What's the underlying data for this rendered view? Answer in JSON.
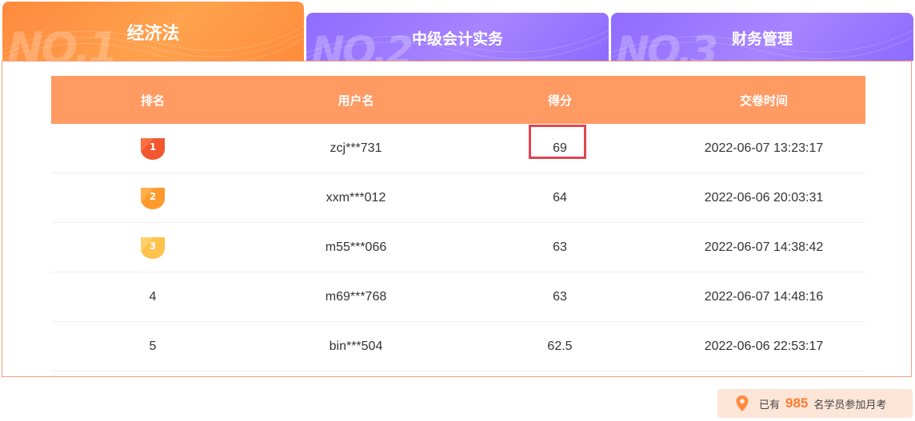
{
  "tabs": [
    {
      "label": "经济法",
      "watermark": "NO.1",
      "active": true
    },
    {
      "label": "中级会计实务",
      "watermark": "NO.2",
      "active": false
    },
    {
      "label": "财务管理",
      "watermark": "NO.3",
      "active": false
    }
  ],
  "table": {
    "headers": [
      "排名",
      "用户名",
      "得分",
      "交卷时间"
    ],
    "rows": [
      {
        "rank": "1",
        "user": "zcj***731",
        "score": "69",
        "time": "2022-06-07 13:23:17"
      },
      {
        "rank": "2",
        "user": "xxm***012",
        "score": "64",
        "time": "2022-06-06 20:03:31"
      },
      {
        "rank": "3",
        "user": "m55***066",
        "score": "63",
        "time": "2022-06-07 14:38:42"
      },
      {
        "rank": "4",
        "user": "m69***768",
        "score": "63",
        "time": "2022-06-07 14:48:16"
      },
      {
        "rank": "5",
        "user": "bin***504",
        "score": "62.5",
        "time": "2022-06-06 22:53:17"
      }
    ]
  },
  "footer": {
    "prefix": "已有",
    "count": "985",
    "suffix": "名学员参加月考"
  },
  "colors": {
    "active_tab": "#ff8a3d",
    "inactive_tab": "#9a78ff",
    "header_bg": "#ff9a63",
    "highlight_border": "#e0464f",
    "count_color": "#ff7a2c",
    "medal_gold": "#f2572f",
    "medal_orange": "#ff9a2e",
    "medal_yellow": "#ffc24a"
  },
  "icons": {
    "location": "location-pin-icon",
    "medal": "rank-medal-icon"
  }
}
